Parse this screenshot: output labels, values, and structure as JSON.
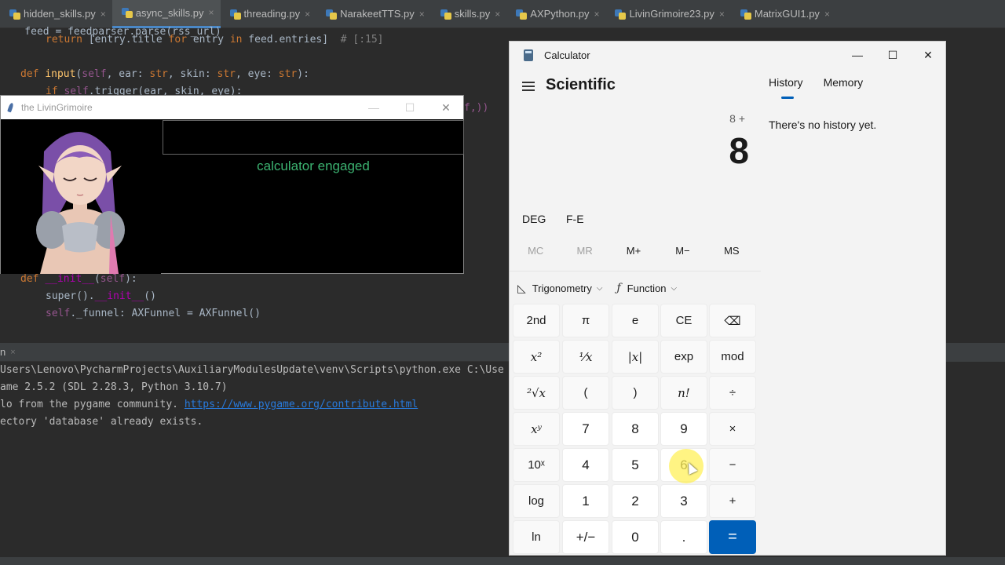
{
  "ide": {
    "tabs": [
      {
        "label": "hidden_skills.py",
        "active": false
      },
      {
        "label": "async_skills.py",
        "active": true
      },
      {
        "label": "threading.py",
        "active": false
      },
      {
        "label": "NarakeetTTS.py",
        "active": false
      },
      {
        "label": "skills.py",
        "active": false
      },
      {
        "label": "AXPython.py",
        "active": false
      },
      {
        "label": "LivinGrimoire23.py",
        "active": false
      },
      {
        "label": "MatrixGUI1.py",
        "active": false
      }
    ],
    "tab_close_glyph": "×",
    "code": {
      "line_feed": "    feed = feedparser.parse(rss_url)",
      "line_return_kw": "return",
      "line_return_body": " [entry.title ",
      "line_return_for": "for",
      "line_return_mid": " entry ",
      "line_return_in": "in",
      "line_return_tail": " feed.entries]",
      "line_return_comment": "  # [:15]",
      "def_kw": "def",
      "def_name": "input",
      "def_params_open": "(",
      "def_self": "self",
      "def_params_rest": ", ear: ",
      "def_type1": "str",
      "def_params_rest2": ", skin: ",
      "def_type2": "str",
      "def_params_rest3": ", eye: ",
      "def_type3": "str",
      "def_params_close": "):",
      "if_kw": "if",
      "if_self": "self",
      "if_rest": ".trigger(ear, skin, eye):",
      "frag_tail": "f,))",
      "init_def": "def",
      "init_name": "__init__",
      "init_open": "(",
      "init_self": "self",
      "init_close": "):",
      "super_call": "super().",
      "super_init": "__init__",
      "super_close": "()",
      "funnel_self": "self",
      "funnel_rest": "._funnel: AXFunnel = AXFunnel()"
    },
    "run": {
      "tab_label": "n",
      "tab_close": "×",
      "lines": [
        "Users\\Lenovo\\PycharmProjects\\AuxiliaryModulesUpdate\\venv\\Scripts\\python.exe C:\\Use",
        "ame 2.5.2 (SDL 2.28.3, Python 3.10.7)"
      ],
      "line3_prefix": "lo from the pygame community. ",
      "line3_link": "https://www.pygame.org/contribute.html",
      "line4": "ectory 'database' already exists."
    }
  },
  "livingrimoire": {
    "title": "the LivinGrimoire",
    "minimize": "—",
    "maximize": "☐",
    "close": "✕",
    "status_text": "calculator engaged",
    "status_color": "#3cb371"
  },
  "calculator": {
    "app_title": "Calculator",
    "minimize": "—",
    "maximize": "☐",
    "close": "✕",
    "mode": "Scientific",
    "expression": "8 +",
    "display_value": "8",
    "angle_unit": "DEG",
    "fe_label": "F-E",
    "memory_buttons": [
      {
        "label": "MC",
        "enabled": false
      },
      {
        "label": "MR",
        "enabled": false
      },
      {
        "label": "M+",
        "enabled": true
      },
      {
        "label": "M−",
        "enabled": true
      },
      {
        "label": "MS",
        "enabled": true
      }
    ],
    "trig_icon": "◺",
    "trig_label": "Trigonometry",
    "func_icon": "ƒ",
    "func_label": "Function",
    "chevron": "⌵",
    "keys": [
      [
        "2nd",
        "π",
        "e",
        "CE",
        "⌫"
      ],
      [
        "x²",
        "¹⁄x",
        "|x|",
        "exp",
        "mod"
      ],
      [
        "²√x",
        "(",
        ")",
        "n!",
        "÷"
      ],
      [
        "xʸ",
        "7",
        "8",
        "9",
        "×"
      ],
      [
        "10ˣ",
        "4",
        "5",
        "6",
        "−"
      ],
      [
        "log",
        "1",
        "2",
        "3",
        "+"
      ],
      [
        "ln",
        "+/−",
        "0",
        ".",
        "="
      ]
    ],
    "history_tab": "History",
    "memory_tab": "Memory",
    "history_message": "There's no history yet.",
    "accent_color": "#005fb8"
  }
}
